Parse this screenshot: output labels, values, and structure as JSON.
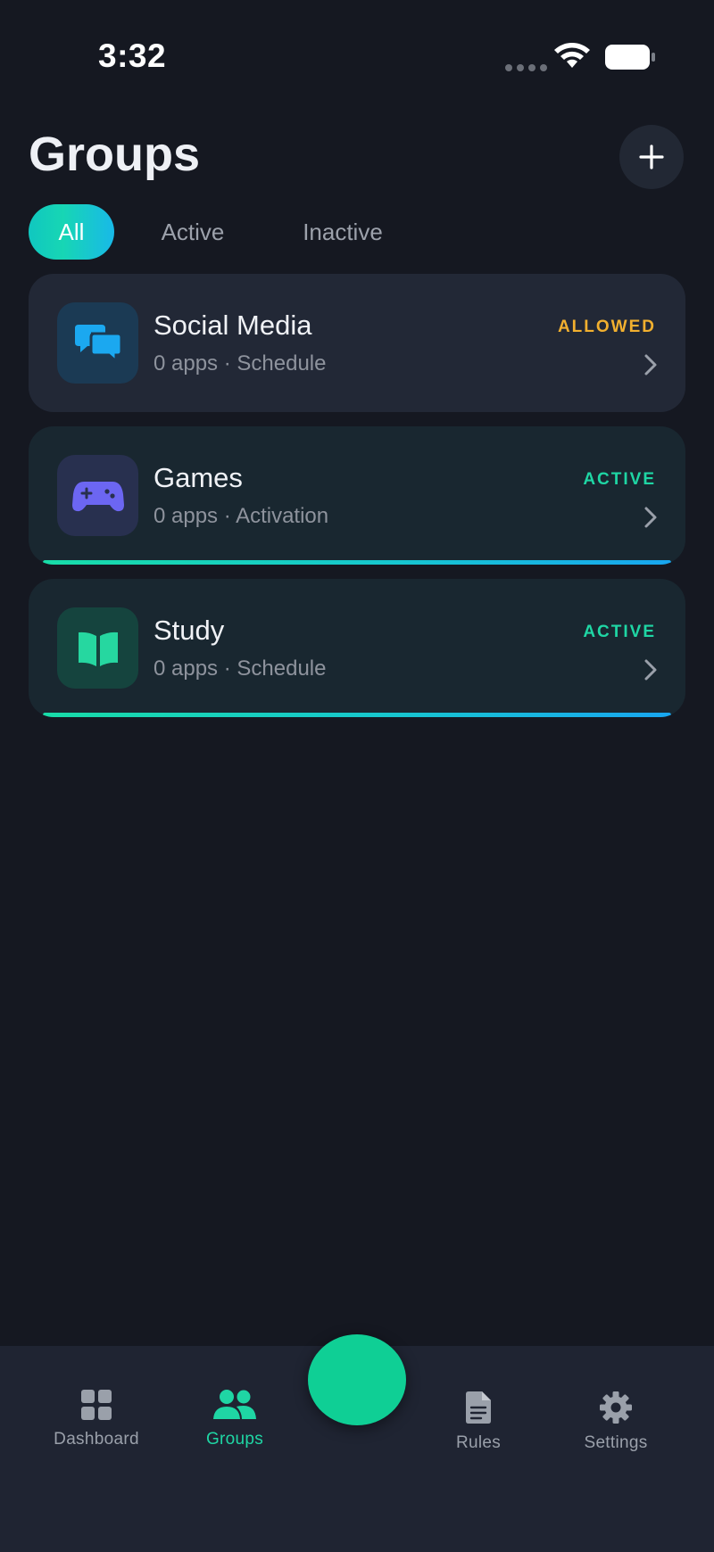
{
  "status_bar": {
    "time": "3:32"
  },
  "header": {
    "title": "Groups",
    "add_icon": "plus-icon"
  },
  "tabs": [
    {
      "label": "All",
      "selected": true
    },
    {
      "label": "Active",
      "selected": false
    },
    {
      "label": "Inactive",
      "selected": false
    }
  ],
  "groups": [
    {
      "name": "Social Media",
      "meta": "0 apps · Schedule",
      "status": "ALLOWED",
      "icon": "chat-bubbles-icon",
      "status_color": "#f2b02f",
      "icon_color": "#1ba8f0",
      "progress": null
    },
    {
      "name": "Games",
      "meta": "0 apps · Activation",
      "status": "ACTIVE",
      "icon": "gamepad-icon",
      "status_color": "#1fd6a4",
      "icon_color": "#6c66f2",
      "progress": 1.0
    },
    {
      "name": "Study",
      "meta": "0 apps · Schedule",
      "status": "ACTIVE",
      "icon": "book-icon",
      "status_color": "#1fd6a4",
      "icon_color": "#26d7a0",
      "progress": 1.0
    }
  ],
  "nav": {
    "items": [
      {
        "label": "Dashboard",
        "icon": "grid-icon",
        "selected": false
      },
      {
        "label": "Groups",
        "icon": "users-icon",
        "selected": true
      },
      {
        "label": "Rules",
        "icon": "document-icon",
        "selected": false
      },
      {
        "label": "Settings",
        "icon": "gear-icon",
        "selected": false
      }
    ],
    "fab_color": "#0fcf95"
  },
  "colors": {
    "background": "#151821",
    "accent": "#1fd6a4",
    "warning": "#f2b02f"
  }
}
